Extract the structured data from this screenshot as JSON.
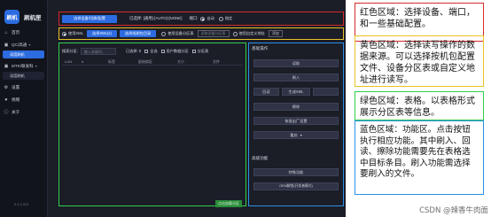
{
  "app": {
    "name": "刷机匣",
    "logo_text": "刷机",
    "version": "5.4.2.911"
  },
  "sidebar": {
    "items": [
      {
        "label": "首页",
        "icon": "home-icon"
      },
      {
        "label": "QC/高通",
        "icon": "chip-icon",
        "sub": "深度刷机"
      },
      {
        "label": "MTK/联发科",
        "icon": "chip-icon",
        "sub": "深度刷机"
      },
      {
        "label": "设置",
        "icon": "gear-icon"
      },
      {
        "label": "捐赠",
        "icon": "gift-icon"
      },
      {
        "label": "关于",
        "icon": "info-icon"
      }
    ]
  },
  "device_bar": {
    "select_button": "选择设备/切换/配置",
    "device_label": "已选择: [通用]-[AUTO]-[NONE]",
    "port_label": "端口:",
    "port_auto": "自动",
    "port_manual": "指定"
  },
  "mode_bar": {
    "opt_xml": "使用XML",
    "btn_select_xml": "选择XML(s)",
    "btn_select_pkg": "选择线刷包目录",
    "opt_device_partition": "使用设备分区表",
    "btn_read_partition": "读取设备分区表",
    "opt_custom": "使用自定义地址",
    "btn_add": "添加"
  },
  "table": {
    "search_label": "搜索分区:",
    "search_placeholder": "输入关键词...",
    "selected_count": "已选择: 0",
    "select_all": "全选",
    "user_data": "用户数据分区",
    "sub_partition": "分区表",
    "columns": [
      "LUN",
      "#",
      "标签",
      "起始扇区",
      "大小",
      "文件"
    ],
    "empty_button": "点击加载分区"
  },
  "functions": {
    "title_basic": "基础操作",
    "btn_read": "读取",
    "btn_write": "刷入",
    "btn_backup": "回读",
    "btn_generate_xml": "生成XML",
    "btn_erase": "擦除",
    "btn_restore": "恢复出厂设置",
    "btn_reboot": "重启",
    "title_advanced": "高级功能",
    "btn_special": "特殊功能",
    "btn_oem": "OEM解锁(开发者模式)"
  },
  "annotations": {
    "red": "红色区域：选择设备、端口，和一些基础配置。",
    "yellow": "黄色区域：选择读写操作的数据来源。可以选择按机包配置文件、设备分区表或自定义地址进行读写。",
    "green": "绿色区域：表格。以表格形式展示分区表等信息。",
    "blue": "蓝色区域：功能区。点击按钮执行相应功能。其中刷入、回读、擦除功能需要先在表格选中目标条目。刷入功能需选择要刷入的文件。"
  },
  "credit": "CSDN @辣香牛肉面",
  "colors": {
    "accent": "#2c6be0",
    "red_frame": "#d62a2a",
    "yellow_frame": "#e9c228",
    "green_frame": "#2fcf4a",
    "blue_frame": "#2a90e8"
  }
}
